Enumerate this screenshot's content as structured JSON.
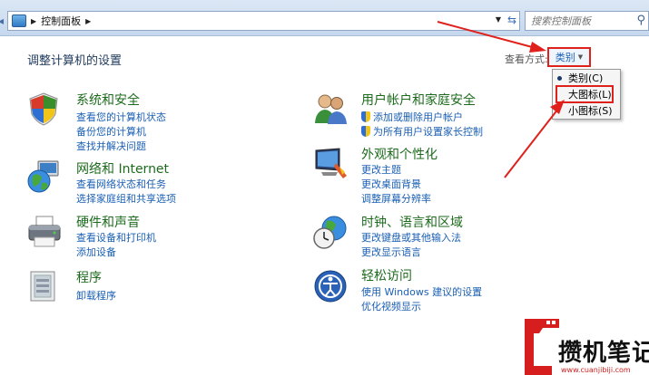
{
  "address": {
    "breadcrumb": "控制面板",
    "search_placeholder": "搜索控制面板"
  },
  "header": {
    "title": "调整计算机的设置",
    "view_by_label": "查看方式:",
    "view_by_value": "类别"
  },
  "view_menu": {
    "items": [
      {
        "label": "类别(C)",
        "selected": true
      },
      {
        "label": "大图标(L)",
        "selected": false
      },
      {
        "label": "小图标(S)",
        "selected": false
      }
    ]
  },
  "categories": {
    "system": {
      "title": "系统和安全",
      "icon": "shield-icon",
      "links": [
        "查看您的计算机状态",
        "备份您的计算机",
        "查找并解决问题"
      ]
    },
    "network": {
      "title": "网络和 Internet",
      "icon": "globe-network-icon",
      "links": [
        "查看网络状态和任务",
        "选择家庭组和共享选项"
      ]
    },
    "hardware": {
      "title": "硬件和声音",
      "icon": "printer-icon",
      "links": [
        "查看设备和打印机",
        "添加设备"
      ]
    },
    "programs": {
      "title": "程序",
      "icon": "programs-icon",
      "links": [
        "卸载程序"
      ]
    },
    "users": {
      "title": "用户帐户和家庭安全",
      "icon": "users-icon",
      "links": [
        "添加或删除用户帐户",
        "为所有用户设置家长控制"
      ]
    },
    "appearance": {
      "title": "外观和个性化",
      "icon": "display-icon",
      "links": [
        "更改主题",
        "更改桌面背景",
        "调整屏幕分辨率"
      ]
    },
    "clock": {
      "title": "时钟、语言和区域",
      "icon": "clock-globe-icon",
      "links": [
        "更改键盘或其他输入法",
        "更改显示语言"
      ]
    },
    "access": {
      "title": "轻松访问",
      "icon": "ease-of-access-icon",
      "links": [
        "使用 Windows 建议的设置",
        "优化视频显示"
      ]
    }
  },
  "watermark": {
    "text": "攒机笔记",
    "url": "www.cuanjibiji.com"
  },
  "colors": {
    "highlight": "#e0201a",
    "link": "#1a5fb4",
    "category_title": "#1c6b1c"
  }
}
